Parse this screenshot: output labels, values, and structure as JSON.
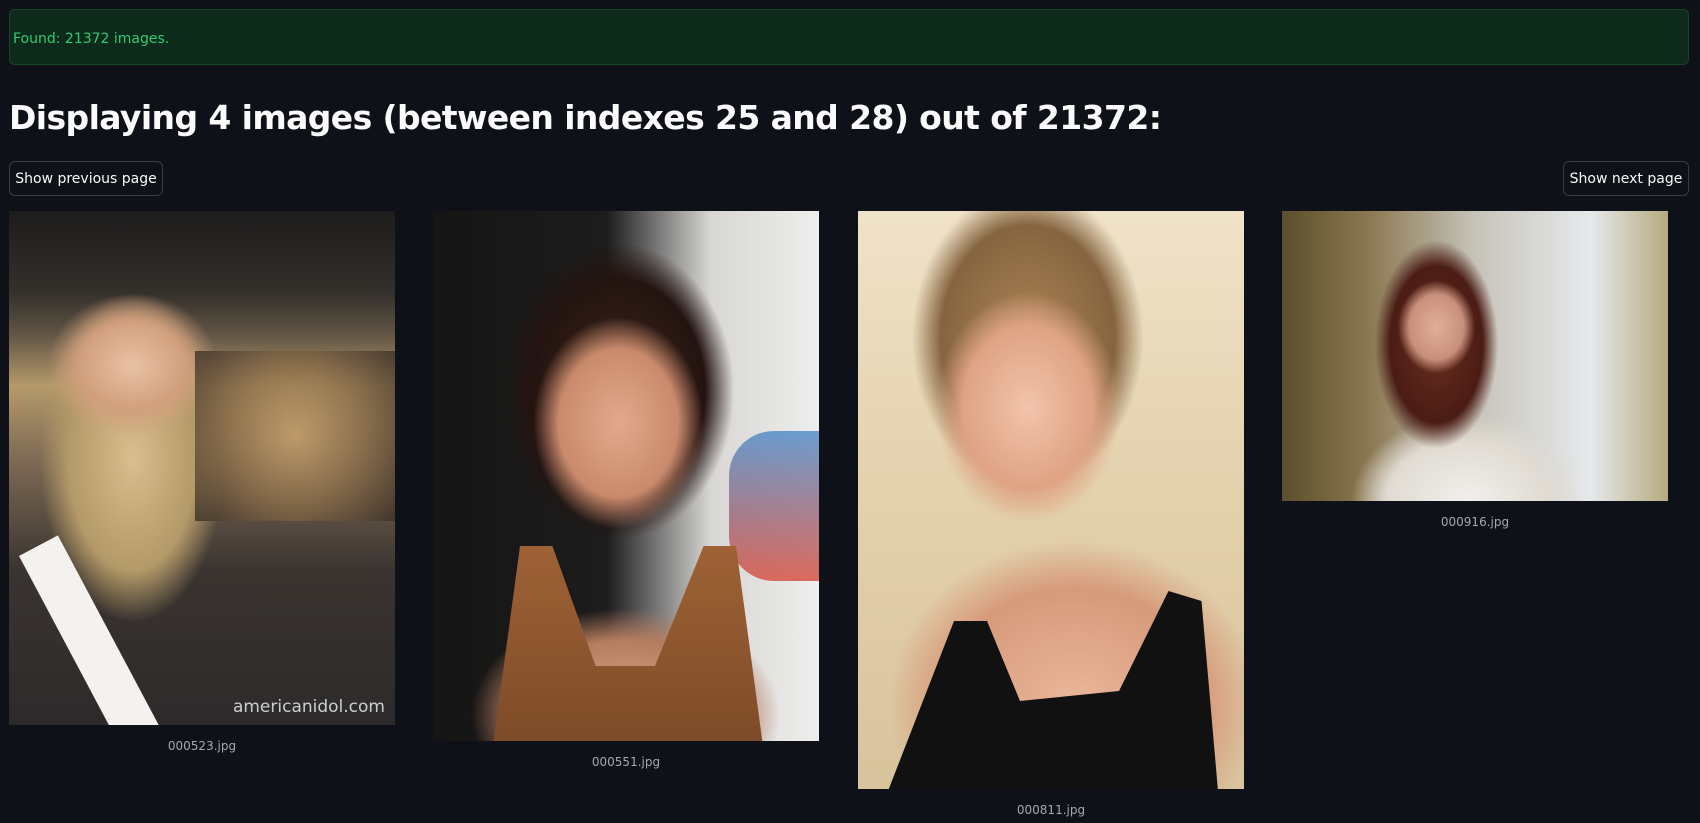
{
  "alert": {
    "text": "Found: 21372 images."
  },
  "header": {
    "title": "Displaying 4 images (between indexes 25 and 28) out of 21372:"
  },
  "pagination": {
    "prev_label": "Show previous page",
    "next_label": "Show next page"
  },
  "gallery": {
    "images": [
      {
        "caption": "000523.jpg",
        "watermark": "americanidol.com"
      },
      {
        "caption": "000551.jpg"
      },
      {
        "caption": "000811.jpg"
      },
      {
        "caption": "000916.jpg"
      }
    ]
  },
  "colors": {
    "background": "#0e1117",
    "success_bg": "#0d2a1b",
    "success_text": "#2ecc71"
  }
}
